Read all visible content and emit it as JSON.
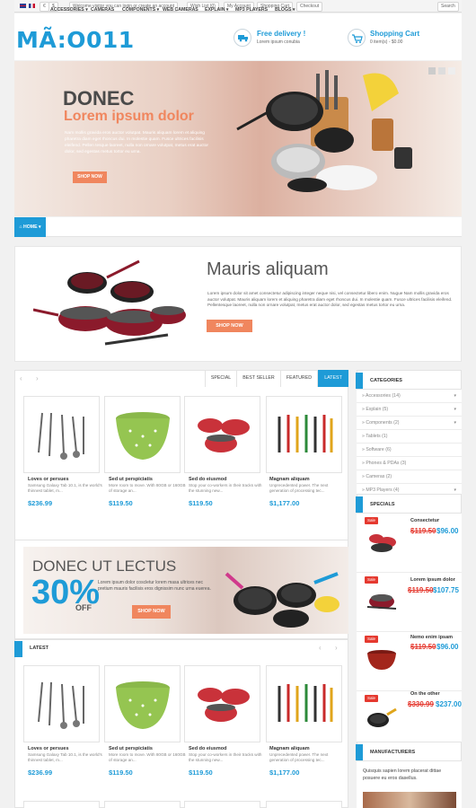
{
  "topbar": {
    "currency_1": "€",
    "currency_2": "$",
    "welcome": "Welcome visitor you can login or create an account",
    "wishlist": "Wish List (0)",
    "account": "My Account",
    "cart": "Shopping Cart",
    "checkout": "Checkout",
    "search": "Search"
  },
  "header": {
    "logo": "MÃ:O011",
    "delivery_title": "Free delivery !",
    "delivery_sub": "Lorem ipsum conubia",
    "cart_title": "Shopping Cart",
    "cart_sub": "0 item(s) - $0.00"
  },
  "slider": {
    "title": "DONEC",
    "subtitle": "Lorem ipsum dolor",
    "body": "Nam mollis gravida eros auctor volutpat. Mauris aliquam lorem et aliquing pharetra diam eget rhoncus dui. In molestie quam. Fusce ultrices facilisis eleifend. Pellen tesque laoreet, nulla non ornare volutpat, metus erat auctor dolor, sed egestas metus tortor eu urna.",
    "button": "SHOP NOW"
  },
  "menu": {
    "home": "HOME",
    "items": [
      "ACCESSORIES",
      "CAMERAS",
      "COMPONENTS",
      "WEB CAMERAS",
      "EXPLAIN",
      "MP3 PLAYERS",
      "BLOGS"
    ]
  },
  "promo": {
    "title": "Mauris aliquam",
    "body": "Lorem ipsum dolor sit amet consectetur adipiscing integer neque nisi, vel consectetur libero enim. Nugue Nam mollis gravida eros auctor volutpat. Mauris aliquam lorem et aliquing pharetra diam eget rhoncus dui. In molestie quam. Fusce ultrices facilisis eleifend. Pellentesque laoreet, nulla non ornare volutpat, metus erat auctor dolor, sed egestas metus tortor eu urna.",
    "button": "SHOP NOW"
  },
  "tabs": [
    "SPECIAL",
    "BEST SELLER",
    "FEATURED",
    "LATEST"
  ],
  "products": [
    {
      "name": "Loves or persues",
      "desc": "Samsung Galaxy Tab 10.1, is the world's thinnest tablet, m...",
      "price": "$236.99"
    },
    {
      "name": "Sed ut perspiciatis",
      "desc": "More room to move. With 80GB or 160GB of storage an...",
      "price": "$119.50"
    },
    {
      "name": "Sed do eiusmod",
      "desc": "Stop your co-workers in their tracks with the stunning new...",
      "price": "$119.50"
    },
    {
      "name": "Magnam aliquam",
      "desc": "Unprecedented power. The next generation of processing tec...",
      "price": "$1,177.00"
    }
  ],
  "banner2": {
    "title": "DONEC UT LECTUS",
    "percent": "30%",
    "off": "OFF",
    "body": "Lorem ipsum dolor coscletur lorem masa ultrices nec pretium mauris facilisis eros dignissim nunc urna euerea.",
    "button": "SHOP NOW"
  },
  "latest": {
    "title": "LATEST"
  },
  "categories": {
    "title": "CATEGORIES",
    "items": [
      "Accessories (14)",
      "Explain (5)",
      "Components (2)",
      "Tablets (1)",
      "Software (6)",
      "Phones & PDAs (3)",
      "Cameras (2)",
      "MP3 Players (4)"
    ]
  },
  "specials": {
    "title": "SPECIALS",
    "sale_label": "Sale",
    "items": [
      {
        "name": "Consectetur",
        "old": "$119.50",
        "new": "$96.00"
      },
      {
        "name": "Lorem ipsum dolor",
        "old": "$119.50",
        "new": "$107.75"
      },
      {
        "name": "Nemo enim ipsam",
        "old": "$119.50",
        "new": "$96.00"
      },
      {
        "name": "On the other",
        "old": "$330.99",
        "new": "$237.00"
      }
    ]
  },
  "manufacturers": {
    "title": "MANUFACTURERS",
    "text": "Quisquis sapien lorem placerat dittae posuere eu eros dasellus."
  },
  "colors": {
    "accent": "#1e9bd7",
    "button": "#f0865e",
    "sale": "#e5392f",
    "old_price": "#e5392f"
  }
}
